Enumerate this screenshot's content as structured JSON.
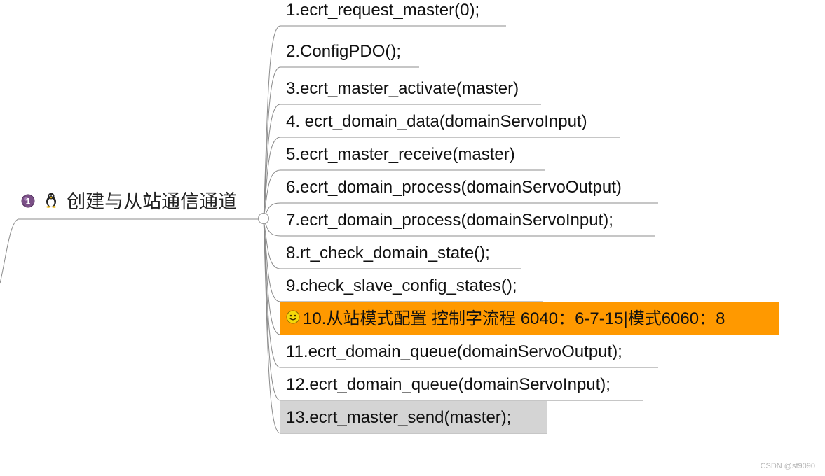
{
  "root": {
    "label": "创建与从站通信通道",
    "icons": [
      "priority-1-icon",
      "tux-penguin-icon"
    ]
  },
  "children": [
    {
      "label": "1.ecrt_request_master(0);"
    },
    {
      "label": "2.ConfigPDO();"
    },
    {
      "label": "3.ecrt_master_activate(master)"
    },
    {
      "label": "4. ecrt_domain_data(domainServoInput)"
    },
    {
      "label": "5.ecrt_master_receive(master)"
    },
    {
      "label": "6.ecrt_domain_process(domainServoOutput)"
    },
    {
      "label": "7.ecrt_domain_process(domainServoInput);"
    },
    {
      "label": "8.rt_check_domain_state();"
    },
    {
      "label": "9.check_slave_config_states();"
    },
    {
      "label": "10.从站模式配置 控制字流程 6040：6-7-15|模式6060：8",
      "icon": "smiley-face-icon",
      "highlight": "#ff9900"
    },
    {
      "label": "11.ecrt_domain_queue(domainServoOutput);"
    },
    {
      "label": "12.ecrt_domain_queue(domainServoInput);"
    },
    {
      "label": "13.ecrt_master_send(master);",
      "highlight": "#d4d4d4"
    }
  ],
  "watermark": "CSDN @sf9090",
  "colors": {
    "connector": "#8c8c8c",
    "underline": "#8c8c8c",
    "highlight_orange": "#ff9900",
    "highlight_gray": "#d4d4d4"
  }
}
